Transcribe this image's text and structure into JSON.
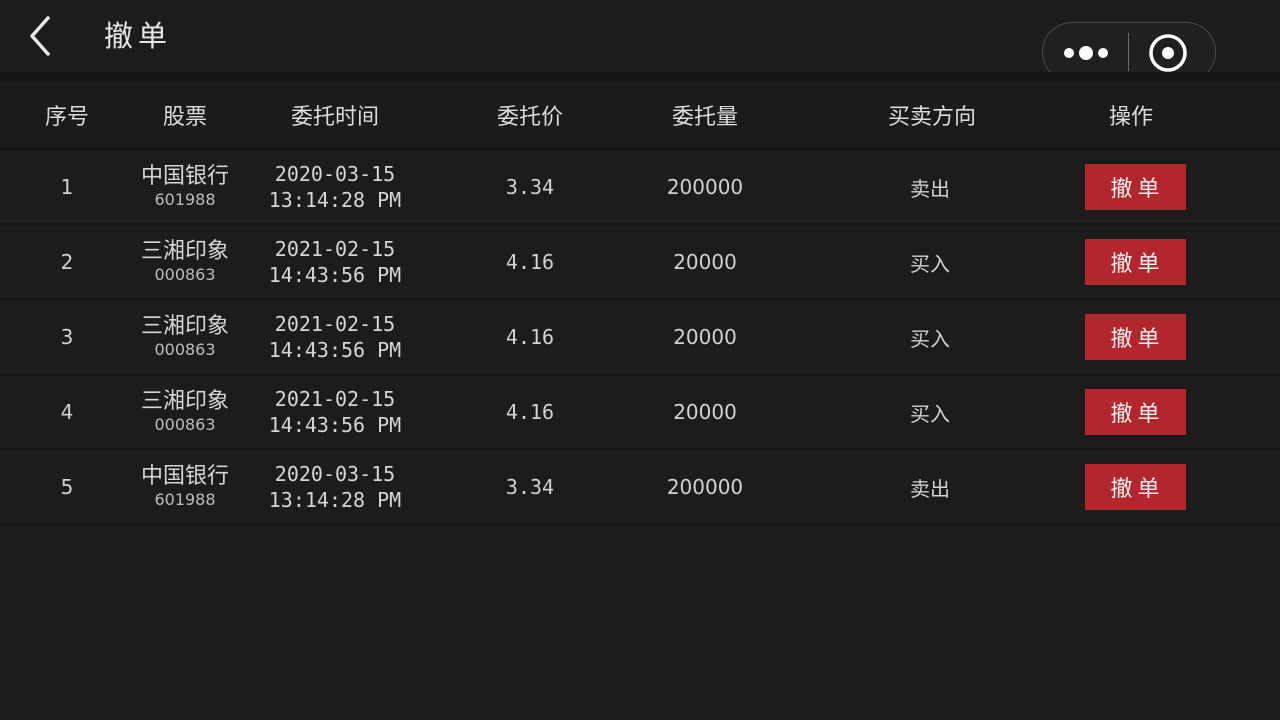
{
  "nav": {
    "title": "撤单",
    "back_icon": "chevron-left-icon",
    "more_icon": "more-dots-icon",
    "close_icon": "target-circle-icon"
  },
  "table": {
    "headers": {
      "no": "序号",
      "stock": "股票",
      "time": "委托时间",
      "price": "委托价",
      "qty": "委托量",
      "side": "买卖方向",
      "op": "操作"
    },
    "rows": [
      {
        "no": "1",
        "stock_name": "中国银行",
        "stock_code": "601988",
        "date": "2020-03-15",
        "time": "13:14:28 PM",
        "price": "3.34",
        "qty": "200000",
        "side": "卖出",
        "action": "撤单"
      },
      {
        "no": "2",
        "stock_name": "三湘印象",
        "stock_code": "000863",
        "date": "2021-02-15",
        "time": "14:43:56 PM",
        "price": "4.16",
        "qty": "20000",
        "side": "买入",
        "action": "撤单"
      },
      {
        "no": "3",
        "stock_name": "三湘印象",
        "stock_code": "000863",
        "date": "2021-02-15",
        "time": "14:43:56 PM",
        "price": "4.16",
        "qty": "20000",
        "side": "买入",
        "action": "撤单"
      },
      {
        "no": "4",
        "stock_name": "三湘印象",
        "stock_code": "000863",
        "date": "2021-02-15",
        "time": "14:43:56 PM",
        "price": "4.16",
        "qty": "20000",
        "side": "买入",
        "action": "撤单"
      },
      {
        "no": "5",
        "stock_name": "中国银行",
        "stock_code": "601988",
        "date": "2020-03-15",
        "time": "13:14:28 PM",
        "price": "3.34",
        "qty": "200000",
        "side": "卖出",
        "action": "撤单"
      }
    ]
  },
  "colors": {
    "background": "#1b1b1b",
    "row": "#1c1c1c",
    "accent_button": "#b1272d",
    "text": "#d6d6d6"
  }
}
